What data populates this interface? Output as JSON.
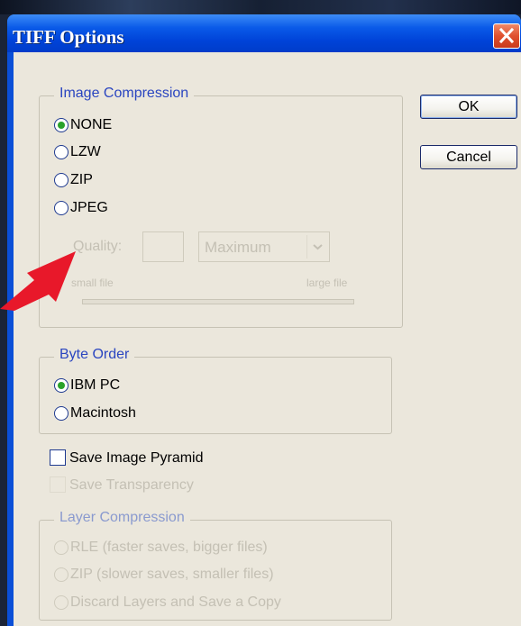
{
  "dialog": {
    "title": "TIFF Options",
    "ok_label": "OK",
    "cancel_label": "Cancel"
  },
  "image_compression": {
    "label": "Image Compression",
    "options": [
      "NONE",
      "LZW",
      "ZIP",
      "JPEG"
    ],
    "selected": "NONE",
    "quality_label": "Quality:",
    "quality_value": "",
    "quality_preset": "Maximum",
    "small_file_label": "small file",
    "large_file_label": "large file"
  },
  "byte_order": {
    "label": "Byte Order",
    "options": [
      "IBM PC",
      "Macintosh"
    ],
    "selected": "IBM PC"
  },
  "checkboxes": {
    "save_image_pyramid": "Save Image Pyramid",
    "save_transparency": "Save Transparency"
  },
  "layer_compression": {
    "label": "Layer Compression",
    "options": [
      "RLE (faster saves, bigger files)",
      "ZIP (slower saves, smaller files)",
      "Discard Layers and Save a Copy"
    ]
  },
  "colors": {
    "titlebar": "#0054e3",
    "dialog_bg": "#ebe7dc",
    "group_label": "#2a45c0",
    "arrow": "#e8182a"
  }
}
